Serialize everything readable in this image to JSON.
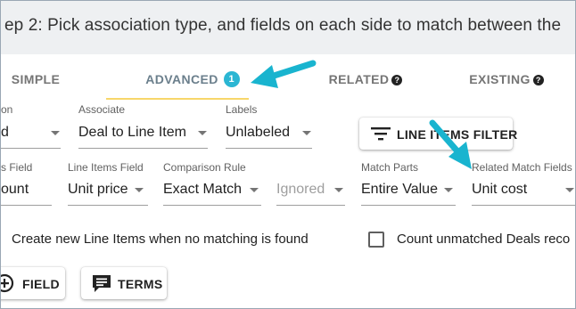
{
  "header": {
    "title": "ep 2: Pick association type, and fields on each side to match between the"
  },
  "tabs": [
    {
      "label": "SIMPLE"
    },
    {
      "label": "ADVANCED",
      "badge": "1"
    },
    {
      "label": "RELATED"
    },
    {
      "label": "EXISTING"
    }
  ],
  "tab_help_glyph": "?",
  "row1": {
    "col1": {
      "label": "on",
      "value": "d"
    },
    "associate": {
      "label": "Associate",
      "value": "Deal to Line Item"
    },
    "labels": {
      "label": "Labels",
      "value": "Unlabeled"
    },
    "filter_button": "LINE ITEMS FILTER"
  },
  "row2": {
    "deals_field": {
      "label": "s Field",
      "value": "ount"
    },
    "line_items_field": {
      "label": "Line Items Field",
      "value": "Unit price"
    },
    "comparison_rule": {
      "label": "Comparison Rule",
      "value": "Exact Match"
    },
    "ignored": {
      "value": "Ignored"
    },
    "match_parts": {
      "label": "Match Parts",
      "value": "Entire Value"
    },
    "related_match_fields": {
      "label": "Related Match Fields",
      "value": "Unit cost"
    }
  },
  "options": {
    "create_new_text": "Create new Line Items when no matching is found",
    "count_unmatched_text": "Count unmatched Deals reco"
  },
  "buttons": {
    "field": "FIELD",
    "terms": "TERMS"
  },
  "colors": {
    "accent": "#2bb6d3",
    "arrow": "#19b4cf",
    "tab_underline": "#f7d66a",
    "header_bg": "#eef0f2"
  },
  "icons": [
    "help-icon",
    "filter-lines-icon",
    "add-circle-icon",
    "comment-icon",
    "arrow-annotation"
  ]
}
